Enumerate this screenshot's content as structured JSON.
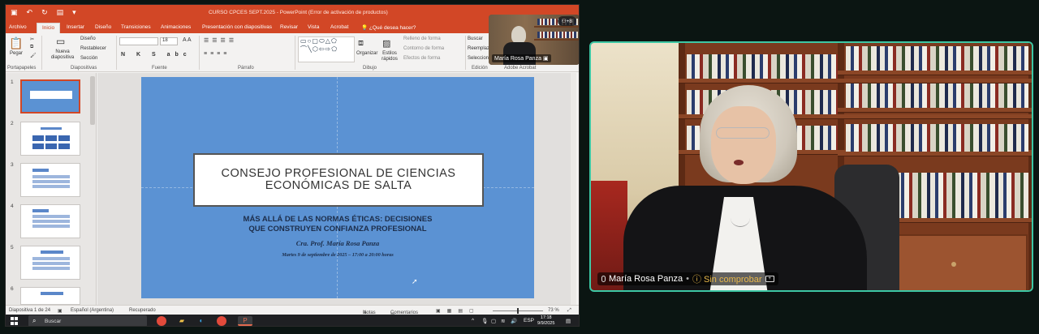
{
  "powerpoint": {
    "window_title": "CURSO CPCES SEPT.2025 - PowerPoint (Error de activación de productos)",
    "tabs": [
      "Archivo",
      "Inicio",
      "Insertar",
      "Diseño",
      "Transiciones",
      "Animaciones",
      "Presentación con diapositivas",
      "Revisar",
      "Vista",
      "Acrobat"
    ],
    "tell_me": "¿Qué desea hacer?",
    "ribbon": {
      "paste": "Pegar",
      "new_slide": "Nueva diapositiva",
      "layout": "Diseño",
      "reset": "Restablecer",
      "section": "Sección",
      "font_size": "18",
      "arrange": "Organizar",
      "quick_styles": "Estilos rápidos",
      "shape_fill": "Relleno de forma",
      "shape_outline": "Contorno de forma",
      "shape_effects": "Efectos de forma",
      "find": "Buscar",
      "replace": "Reemplazar",
      "select": "Seleccionar",
      "groups": [
        "Portapapeles",
        "Diapositivas",
        "Fuente",
        "Párrafo",
        "Dibujo",
        "Edición",
        "Adobe Acrobat"
      ]
    },
    "thumbnails": [
      "1",
      "2",
      "3",
      "4",
      "5",
      "6"
    ],
    "slide": {
      "title": "CONSEJO PROFESIONAL DE CIENCIAS ECONÓMICAS DE SALTA",
      "subtitle_line1": "MÁS ALLÁ DE LAS NORMAS ÉTICAS: DECISIONES",
      "subtitle_line2": "QUE CONSTRUYEN CONFIANZA PROFESIONAL",
      "author": "Cra. Prof. María Rosa Panza",
      "date": "Martes 9 de septiembre de 2025 – 17:00 a 20:00 horas"
    },
    "status": {
      "slide_count": "Diapositiva 1 de 24",
      "language": "Español (Argentina)",
      "recovered": "Recuperado",
      "notes": "Notas",
      "comments": "Comentarios",
      "zoom": "73 %"
    }
  },
  "taskbar": {
    "search": "Buscar",
    "lang": "ESP",
    "time": "17:18",
    "date": "9/9/2025"
  },
  "self_view": {
    "name": "María Rosa Panza",
    "participants_extra": "+8"
  },
  "participant": {
    "name": "María Rosa Panza",
    "status": "Sin comprobar",
    "accent_color": "#3dc7a4"
  }
}
